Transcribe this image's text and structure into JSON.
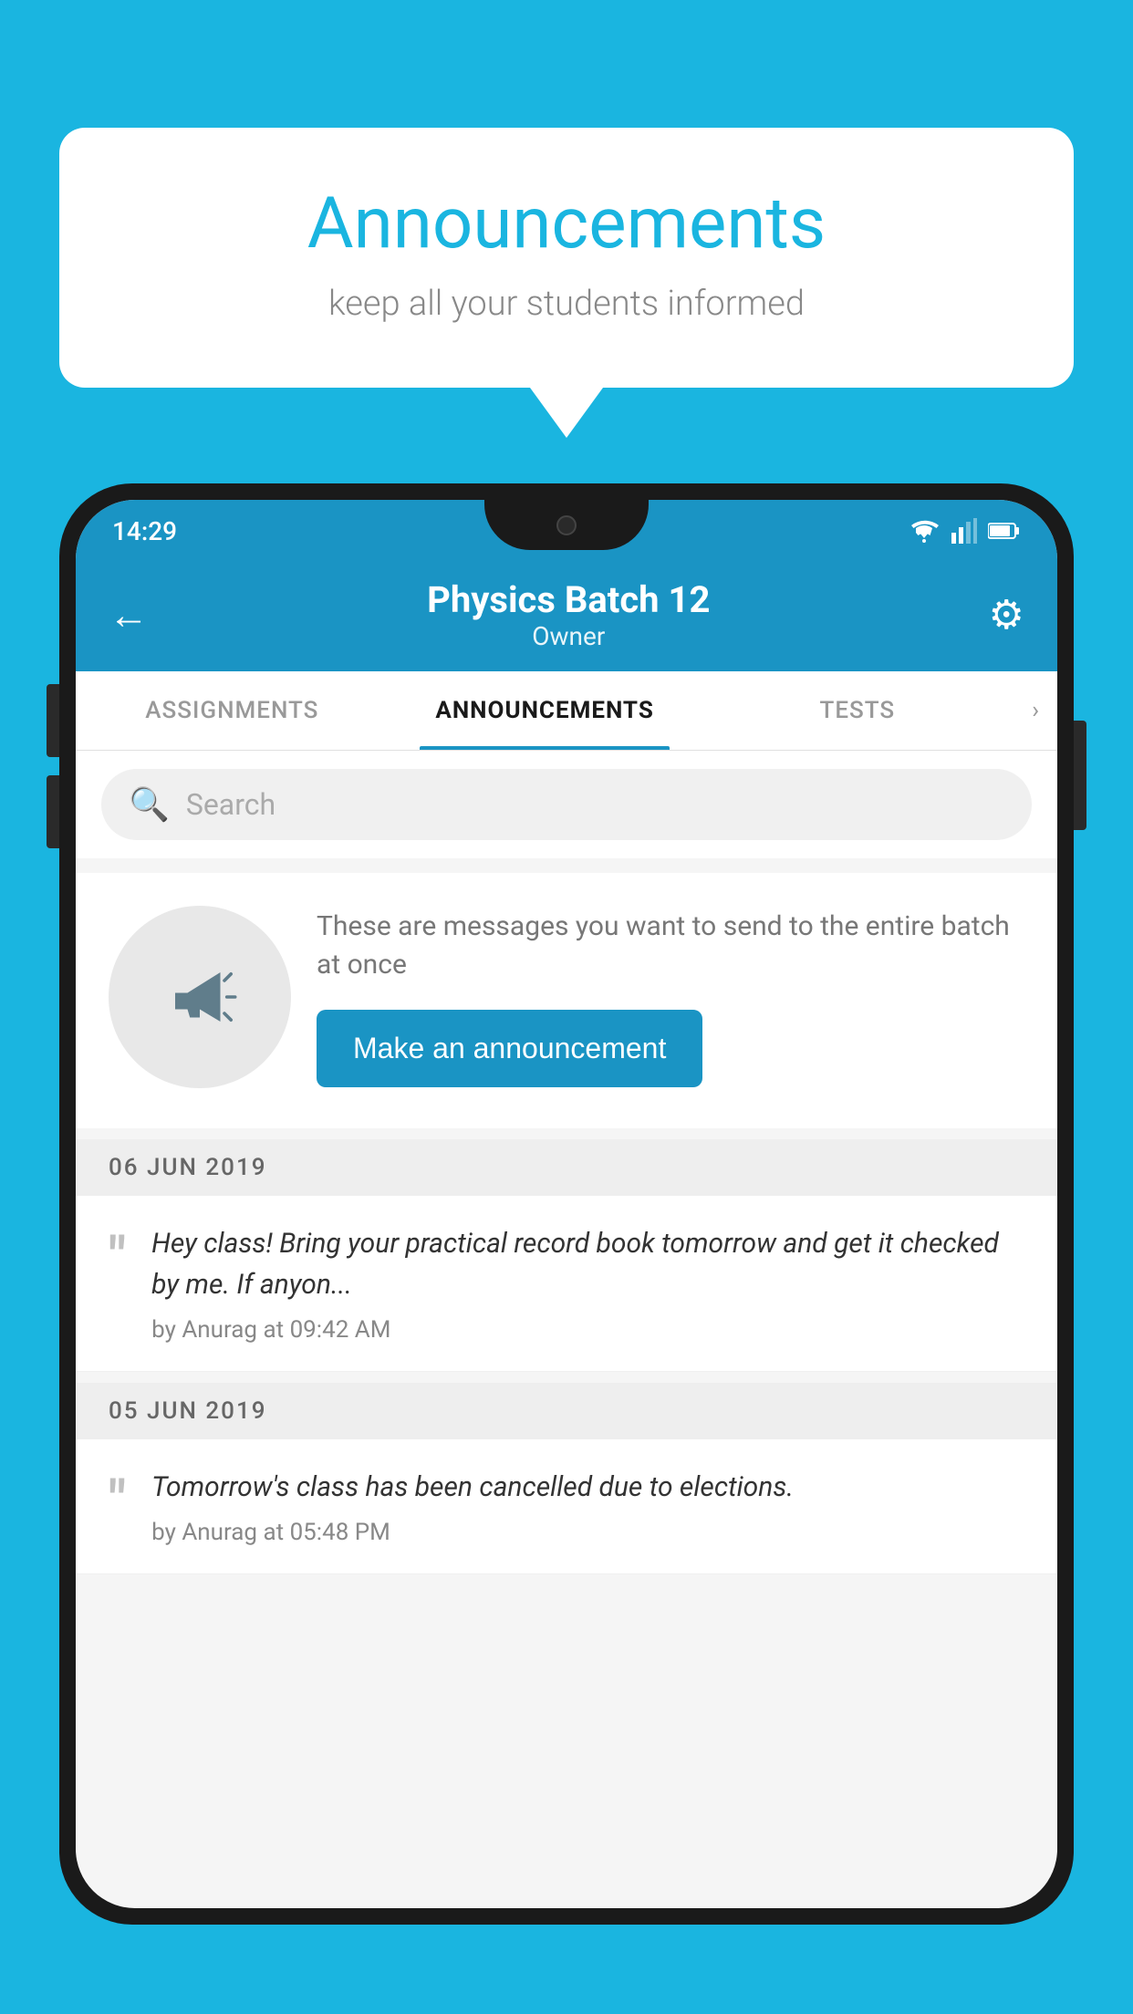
{
  "page": {
    "background_color": "#1ab5e0"
  },
  "speech_bubble": {
    "title": "Announcements",
    "subtitle": "keep all your students informed",
    "title_color": "#1ab5e0",
    "subtitle_color": "#888888"
  },
  "status_bar": {
    "time": "14:29",
    "bg_color": "#1a94c4"
  },
  "app_header": {
    "title": "Physics Batch 12",
    "subtitle": "Owner",
    "bg_color": "#1a94c4"
  },
  "tabs": {
    "items": [
      {
        "label": "ASSIGNMENTS",
        "active": false
      },
      {
        "label": "ANNOUNCEMENTS",
        "active": true
      },
      {
        "label": "TESTS",
        "active": false
      }
    ],
    "more_label": "›"
  },
  "search": {
    "placeholder": "Search"
  },
  "promo": {
    "description": "These are messages you want to send to the entire batch at once",
    "button_label": "Make an announcement"
  },
  "date_separators": [
    {
      "label": "06  JUN  2019"
    },
    {
      "label": "05  JUN  2019"
    }
  ],
  "announcements": [
    {
      "text": "Hey class! Bring your practical record book tomorrow and get it checked by me. If anyon...",
      "meta": "by Anurag at 09:42 AM"
    },
    {
      "text": "Tomorrow's class has been cancelled due to elections.",
      "meta": "by Anurag at 05:48 PM"
    }
  ]
}
